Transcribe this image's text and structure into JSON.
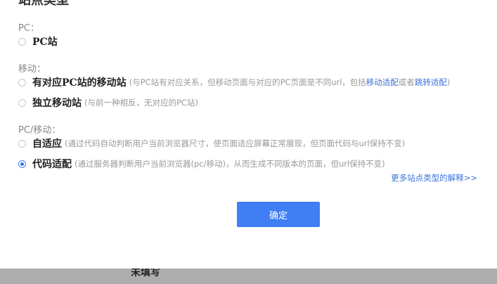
{
  "dialog": {
    "partial_heading": "站点类型",
    "confirm_label": "确定",
    "more_link": "更多站点类型的解释>>"
  },
  "groups": [
    {
      "label": "PC：",
      "options": [
        {
          "label": "PC站",
          "desc": "",
          "selected": false
        }
      ]
    },
    {
      "label": "移动：",
      "options": [
        {
          "label": "有对应PC站的移动站",
          "desc_prefix": "(与PC站有对应关系，但移动页面与对应的PC页面是不同url，包括",
          "link1": "移动适配",
          "desc_middle": "或者",
          "link2": "跳转适配",
          "desc_suffix": ")",
          "selected": false
        },
        {
          "label": "独立移动站",
          "desc": "(与前一种相反，无对应的PC站)",
          "selected": false
        }
      ]
    },
    {
      "label": "PC/移动：",
      "options": [
        {
          "label": "自适应",
          "desc": "(通过代码自动判断用户当前浏览器尺寸，使页面适应屏幕正常展现，但页面代码与url保持不变)",
          "selected": false
        },
        {
          "label": "代码适配",
          "desc": "(通过服务器判断用户当前浏览器(pc/移动)，从而生成不同版本的页面，但url保持不变)",
          "selected": true
        }
      ]
    }
  ],
  "background": {
    "partial_text": "未填写"
  },
  "colors": {
    "accent": "#3f7ef5",
    "link": "#3a73d9",
    "muted": "#999999"
  }
}
